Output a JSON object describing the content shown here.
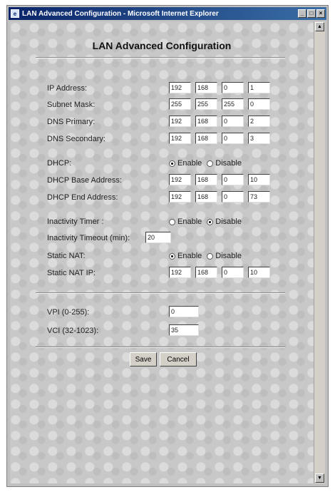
{
  "window": {
    "title": "LAN Advanced Configuration - Microsoft Internet Explorer",
    "minimize": "_",
    "maximize": "□",
    "close": "×"
  },
  "page": {
    "heading": "LAN Advanced Configuration"
  },
  "fields": {
    "ip_address": {
      "label": "IP Address:",
      "octets": [
        "192",
        "168",
        "0",
        "1"
      ]
    },
    "subnet_mask": {
      "label": "Subnet Mask:",
      "octets": [
        "255",
        "255",
        "255",
        "0"
      ]
    },
    "dns_primary": {
      "label": "DNS Primary:",
      "octets": [
        "192",
        "168",
        "0",
        "2"
      ]
    },
    "dns_secondary": {
      "label": "DNS Secondary:",
      "octets": [
        "192",
        "168",
        "0",
        "3"
      ]
    },
    "dhcp": {
      "label": "DHCP:",
      "enable": "Enable",
      "disable": "Disable",
      "selected": "Enable"
    },
    "dhcp_base": {
      "label": "DHCP Base Address:",
      "octets": [
        "192",
        "168",
        "0",
        "10"
      ]
    },
    "dhcp_end": {
      "label": "DHCP End Address:",
      "octets": [
        "192",
        "168",
        "0",
        "73"
      ]
    },
    "inactivity_timer": {
      "label": "Inactivity Timer :",
      "enable": "Enable",
      "disable": "Disable",
      "selected": "Disable"
    },
    "inactivity_timeout": {
      "label": "Inactivity Timeout (min):",
      "value": "20"
    },
    "static_nat": {
      "label": "Static NAT:",
      "enable": "Enable",
      "disable": "Disable",
      "selected": "Enable"
    },
    "static_nat_ip": {
      "label": "Static NAT IP:",
      "octets": [
        "192",
        "168",
        "0",
        "10"
      ]
    },
    "vpi": {
      "label": "VPI (0-255):",
      "value": "0"
    },
    "vci": {
      "label": "VCI (32-1023):",
      "value": "35"
    }
  },
  "buttons": {
    "save": "Save",
    "cancel": "Cancel"
  }
}
